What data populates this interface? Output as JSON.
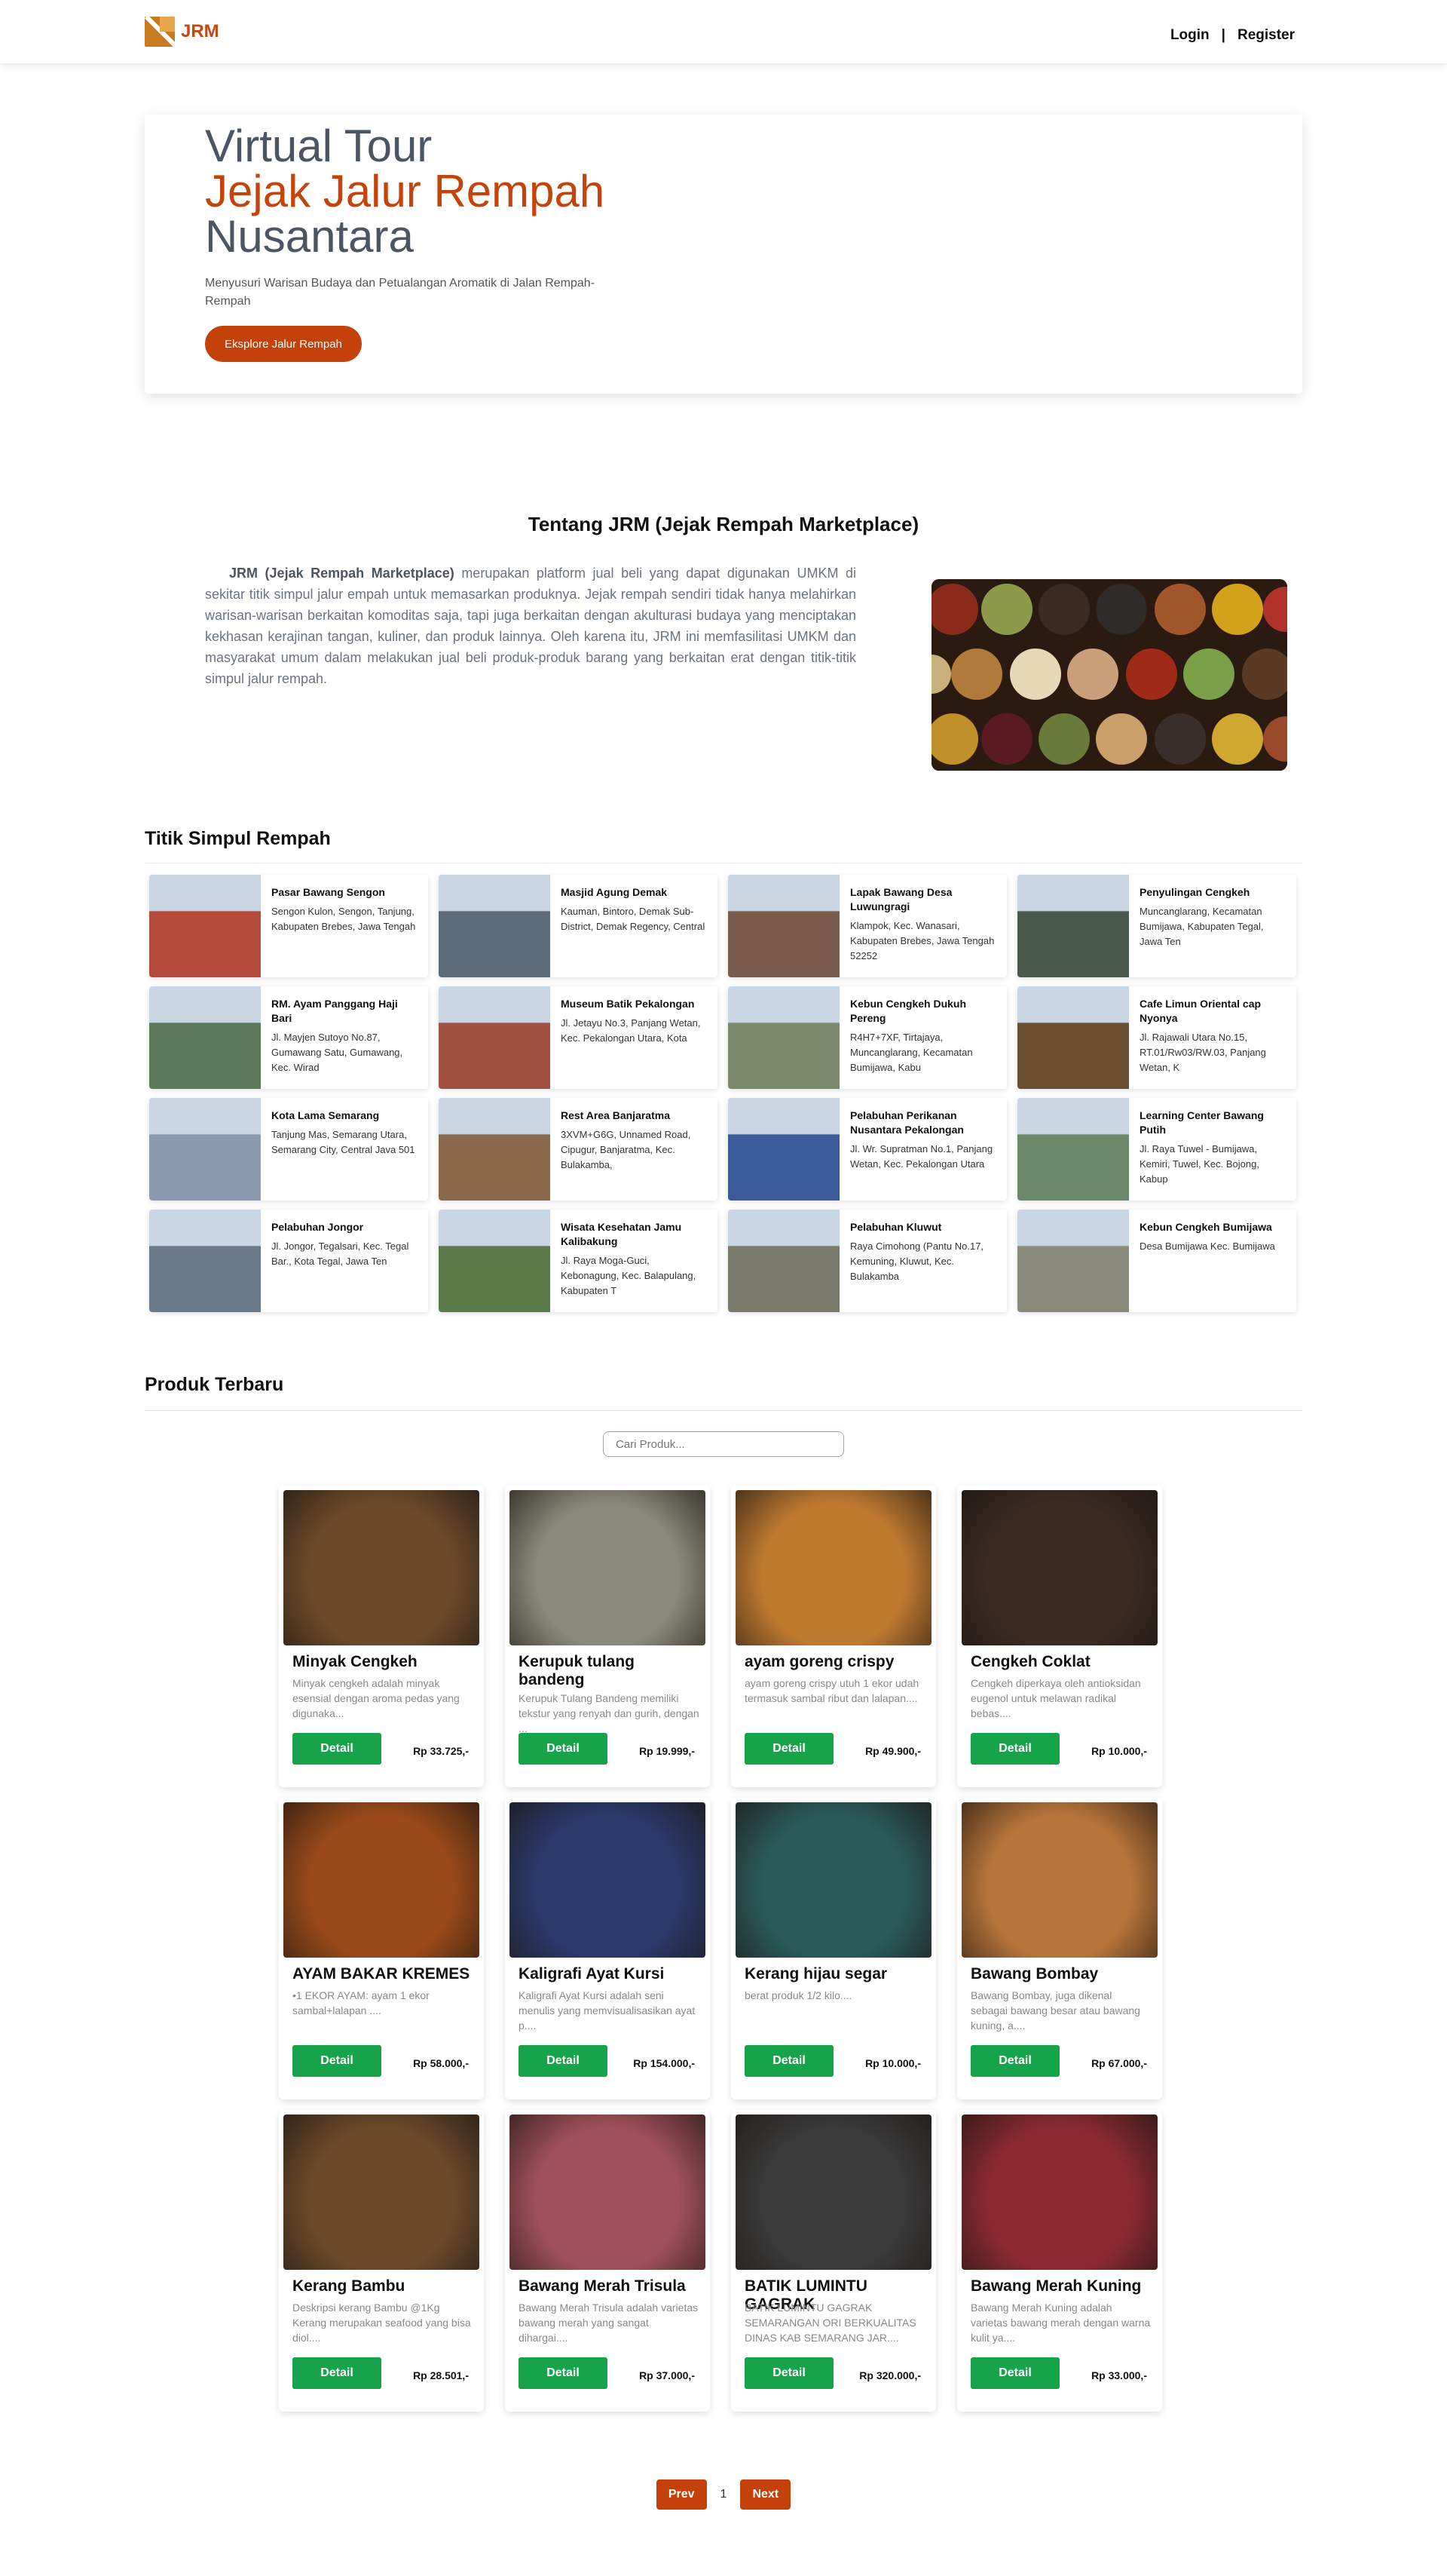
{
  "nav": {
    "brand": "JRM",
    "login": "Login",
    "separator": "|",
    "register": "Register"
  },
  "hero": {
    "title_line1": "Virtual Tour",
    "title_line2": "Jejak Jalur Rempah",
    "title_line3": "Nusantara",
    "subtitle": "Menyusuri Warisan Budaya dan Petualangan Aromatik di Jalan Rempah-Rempah",
    "button": "Eksplore Jalur Rempah"
  },
  "about": {
    "title": "Tentang JRM (Jejak Rempah Marketplace)",
    "bold": "JRM (Jejak Rempah Marketplace)",
    "text": " merupakan platform jual beli yang dapat digunakan UMKM di sekitar titik simpul jalur empah untuk memasarkan produknya. Jejak rempah sendiri tidak hanya melahirkan warisan-warisan berkaitan komoditas saja, tapi juga berkaitan dengan akulturasi budaya yang menciptakan kekhasan kerajinan tangan, kuliner, dan produk lainnya. Oleh karena itu, JRM ini memfasilitasi UMKM dan masyarakat umum dalam melakukan jual beli produk-produk barang yang berkaitan erat dengan titik-titik simpul jalur rempah."
  },
  "points_title": "Titik Simpul Rempah",
  "points": [
    {
      "name": "Pasar Bawang Sengon",
      "address": "Sengon Kulon, Sengon, Tanjung, Kabupaten Brebes, Jawa Tengah",
      "color": "#b44a3a"
    },
    {
      "name": "Masjid Agung Demak",
      "address": "Kauman, Bintoro, Demak Sub-District, Demak Regency, Central",
      "color": "#5c6b7a"
    },
    {
      "name": "Lapak Bawang Desa Luwungragi",
      "address": "Klampok, Kec. Wanasari, Kabupaten Brebes, Jawa Tengah 52252",
      "color": "#7a5a4a"
    },
    {
      "name": "Penyulingan Cengkeh",
      "address": "Muncanglarang, Kecamatan Bumijawa, Kabupaten Tegal, Jawa Ten",
      "color": "#4a5a4a"
    },
    {
      "name": "RM. Ayam Panggang Haji Bari",
      "address": "Jl. Mayjen Sutoyo No.87, Gumawang Satu, Gumawang, Kec. Wirad",
      "color": "#5a7a5a"
    },
    {
      "name": "Museum Batik Pekalongan",
      "address": "Jl. Jetayu No.3, Panjang Wetan, Kec. Pekalongan Utara, Kota",
      "color": "#a05040"
    },
    {
      "name": "Kebun Cengkeh Dukuh Pereng",
      "address": "R4H7+7XF, Tirtajaya, Muncanglarang, Kecamatan Bumijawa, Kabu",
      "color": "#7a8a6a"
    },
    {
      "name": "Cafe Limun Oriental cap Nyonya",
      "address": "Jl. Rajawali Utara No.15, RT.01/Rw03/RW.03, Panjang Wetan, K",
      "color": "#6a5030"
    },
    {
      "name": "Kota Lama Semarang",
      "address": "Tanjung Mas, Semarang Utara, Semarang City, Central Java 501",
      "color": "#8a9ab0"
    },
    {
      "name": "Rest Area Banjaratma",
      "address": "3XVM+G6G, Unnamed Road, Cipugur, Banjaratma, Kec. Bulakamba,",
      "color": "#8a6a4a"
    },
    {
      "name": "Pelabuhan Perikanan Nusantara Pekalongan",
      "address": "Jl. Wr. Supratman No.1, Panjang Wetan, Kec. Pekalongan Utara",
      "color": "#3a5a9a"
    },
    {
      "name": "Learning Center Bawang Putih",
      "address": "Jl. Raya Tuwel - Bumijawa, Kemiri, Tuwel, Kec. Bojong, Kabup",
      "color": "#6a8a6a"
    },
    {
      "name": "Pelabuhan Jongor",
      "address": "Jl. Jongor, Tegalsari, Kec. Tegal Bar., Kota Tegal, Jawa Ten",
      "color": "#6a7a8a"
    },
    {
      "name": "Wisata Kesehatan Jamu Kalibakung",
      "address": "Jl. Raya Moga-Guci, Kebonagung, Kec. Balapulang, Kabupaten T",
      "color": "#5a7a4a"
    },
    {
      "name": "Pelabuhan Kluwut",
      "address": "Raya Cimohong (Pantu No.17, Kemuning, Kluwut, Kec. Bulakamba",
      "color": "#7a7a6a"
    },
    {
      "name": "Kebun Cengkeh Bumijawa",
      "address": "Desa Bumijawa Kec. Bumijawa",
      "color": "#8a8a7a"
    }
  ],
  "products_title": "Produk Terbaru",
  "search": {
    "placeholder": "Cari Produk..."
  },
  "products": [
    {
      "name": "Minyak Cengkeh",
      "desc": "Minyak cengkeh adalah minyak esensial dengan aroma pedas yang digunaka...",
      "price": "Rp 33.725,-",
      "button": "Detail",
      "color": "#6b4a2a"
    },
    {
      "name": "Kerupuk tulang bandeng",
      "desc": "Kerupuk Tulang Bandeng memiliki tekstur yang renyah dan gurih, dengan ...",
      "price": "Rp 19.999,-",
      "button": "Detail",
      "color": "#8a8a7a"
    },
    {
      "name": "ayam goreng crispy",
      "desc": "ayam goreng crispy utuh 1 ekor udah termasuk sambal ribut dan lalapan....",
      "price": "Rp 49.900,-",
      "button": "Detail",
      "color": "#c07a30"
    },
    {
      "name": "Cengkeh Coklat",
      "desc": "Cengkeh diperkaya oleh antioksidan eugenol untuk melawan radikal bebas....",
      "price": "Rp 10.000,-",
      "button": "Detail",
      "color": "#3a2a22"
    },
    {
      "name": "AYAM BAKAR KREMES",
      "desc": "•1 EKOR AYAM: ayam 1 ekor sambal+lalapan ....",
      "price": "Rp 58.000,-",
      "button": "Detail",
      "color": "#9a4a1a"
    },
    {
      "name": "Kaligrafi Ayat Kursi",
      "desc": "Kaligrafi Ayat Kursi adalah seni menulis yang memvisualisasikan ayat p....",
      "price": "Rp 154.000,-",
      "button": "Detail",
      "color": "#2a3a6a"
    },
    {
      "name": "Kerang hijau segar",
      "desc": "berat produk 1/2 kilo....",
      "price": "Rp 10.000,-",
      "button": "Detail",
      "color": "#2a5a5a"
    },
    {
      "name": "Bawang Bombay",
      "desc": "Bawang Bombay, juga dikenal sebagai bawang besar atau bawang kuning, a....",
      "price": "Rp 67.000,-",
      "button": "Detail",
      "color": "#b8753a"
    },
    {
      "name": "Kerang Bambu",
      "desc": "Deskripsi kerang Bambu @1Kg Kerang merupakan seafood yang bisa diol....",
      "price": "Rp 28.501,-",
      "button": "Detail",
      "color": "#6a4a2a"
    },
    {
      "name": "Bawang Merah Trisula",
      "desc": "Bawang Merah Trisula adalah varietas bawang merah yang sangat dihargai....",
      "price": "Rp 37.000,-",
      "button": "Detail",
      "color": "#a0505a"
    },
    {
      "name": "BATIK LUMINTU GAGRAK",
      "desc": "BATIK LUMINTU GAGRAK SEMARANGAN ORI BERKUALITAS DINAS KAB SEMARANG JAR....",
      "price": "Rp 320.000,-",
      "button": "Detail",
      "color": "#3a3a3a"
    },
    {
      "name": "Bawang Merah Kuning",
      "desc": "Bawang Merah Kuning adalah varietas bawang merah dengan warna kulit ya....",
      "price": "Rp 33.000,-",
      "button": "Detail",
      "color": "#8a2a30"
    }
  ],
  "pagination": {
    "prev": "Prev",
    "page": "1",
    "next": "Next"
  }
}
